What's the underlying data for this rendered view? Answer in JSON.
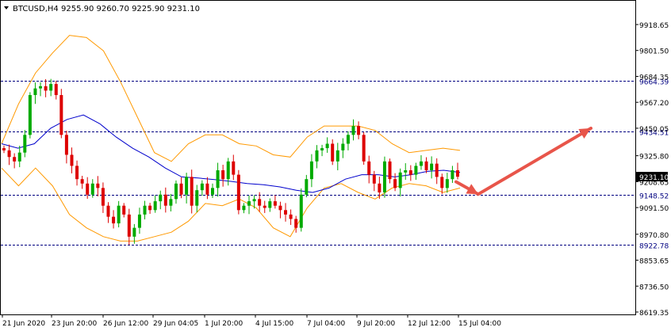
{
  "header": {
    "symbol": "BTCUSD,H4",
    "ohlc": "9255.90 9260.70 9225.90 9231.10"
  },
  "colors": {
    "up": "#00aa00",
    "down": "#dd0000",
    "ma": "#0000cc",
    "bands": "#ff9900",
    "levels": "#000080",
    "arrow": "#e8554a"
  },
  "chart_data": {
    "type": "candlestick",
    "title": "BTCUSD,H4",
    "ylim": [
      8619.35,
      9977.0
    ],
    "y_ticks": [
      "9918.65",
      "9801.50",
      "9684.35",
      "9567.20",
      "9450.05",
      "9325.80",
      "9208.65",
      "9091.50",
      "8970.80",
      "8853.65",
      "8736.50",
      "8619.35"
    ],
    "x_tick_labels": [
      "21 Jun 2020",
      "23 Jun 20:00",
      "26 Jun 12:00",
      "29 Jun 04:05",
      "1 Jul 20:00",
      "4 Jul 15:00",
      "7 Jul 04:00",
      "9 Jul 20:00",
      "12 Jul 12:00",
      "15 Jul 04:00"
    ],
    "horizontal_levels": [
      {
        "value": 9664.39,
        "label": "9664.39"
      },
      {
        "value": 9434.51,
        "label": "9434.51"
      },
      {
        "value": 9148.52,
        "label": "9148.52"
      },
      {
        "value": 8922.78,
        "label": "8922.78"
      }
    ],
    "current_price": {
      "value": 9231.1,
      "label": "9231.10"
    },
    "close_path": [
      9350,
      9320,
      9300,
      9340,
      9420,
      9600,
      9630,
      9640,
      9620,
      9650,
      9600,
      9420,
      9330,
      9280,
      9220,
      9200,
      9150,
      9200,
      9180,
      9100,
      9050,
      9020,
      9100,
      9060,
      8960,
      9000,
      9060,
      9100,
      9080,
      9120,
      9150,
      9100,
      9130,
      9200,
      9150,
      9230,
      9100,
      9170,
      9200,
      9150,
      9180,
      9260,
      9220,
      9300,
      9240,
      9080,
      9100,
      9120,
      9130,
      9100,
      9090,
      9120,
      9100,
      9080,
      9060,
      9040,
      9000,
      9150,
      9220,
      9300,
      9350,
      9360,
      9380,
      9300,
      9350,
      9380,
      9420,
      9460,
      9420,
      9300,
      9240,
      9200,
      9160,
      9300,
      9220,
      9180,
      9250,
      9260,
      9240,
      9280,
      9300,
      9260,
      9290,
      9230,
      9180,
      9220,
      9260,
      9231
    ],
    "ma_path": [
      9380,
      9360,
      9380,
      9450,
      9490,
      9510,
      9470,
      9410,
      9360,
      9320,
      9270,
      9230,
      9225,
      9218,
      9210,
      9200,
      9195,
      9185,
      9170,
      9160,
      9180,
      9220,
      9240,
      9240,
      9230,
      9240,
      9255,
      9260,
      9250
    ],
    "upper_band_path": [
      9380,
      9560,
      9700,
      9790,
      9870,
      9860,
      9800,
      9660,
      9500,
      9340,
      9300,
      9380,
      9420,
      9420,
      9380,
      9370,
      9330,
      9320,
      9410,
      9460,
      9460,
      9460,
      9440,
      9380,
      9340,
      9350,
      9360,
      9350
    ],
    "lower_band_path": [
      9270,
      9190,
      9270,
      9190,
      9060,
      9000,
      8960,
      8940,
      8940,
      8960,
      8980,
      9030,
      9110,
      9100,
      9130,
      9090,
      9000,
      8960,
      9090,
      9180,
      9200,
      9160,
      9130,
      9180,
      9200,
      9190,
      9160,
      9180
    ],
    "forecast_arrows": [
      {
        "from": [
          575,
          9208
        ],
        "to": [
          603,
          9152
        ]
      },
      {
        "from": [
          603,
          9152
        ],
        "to": [
          745,
          9450
        ]
      }
    ]
  }
}
